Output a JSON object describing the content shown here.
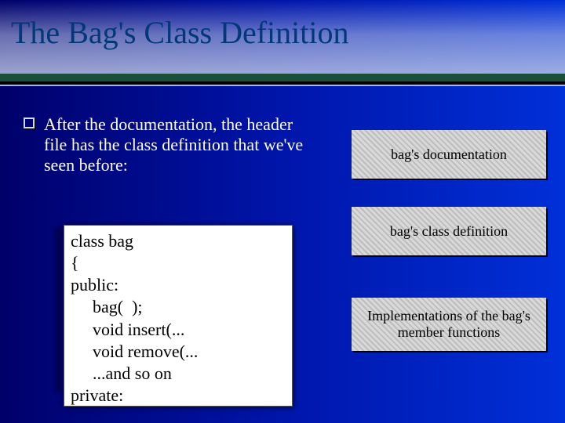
{
  "slide": {
    "title": "The Bag's Class Definition",
    "bullet": "After the documentation, the header file has the class definition that we've seen before:",
    "code": {
      "l1": "class bag",
      "l2": "{",
      "l3": "public:",
      "l4": "bag(  );",
      "l5": "void insert(...",
      "l6": "void remove(...",
      "l7": "...and so on",
      "l8": "private:"
    },
    "boxes": {
      "doc": "bag's documentation",
      "def": "bag's class definition",
      "impl": "Implementations of the bag's member functions"
    }
  }
}
